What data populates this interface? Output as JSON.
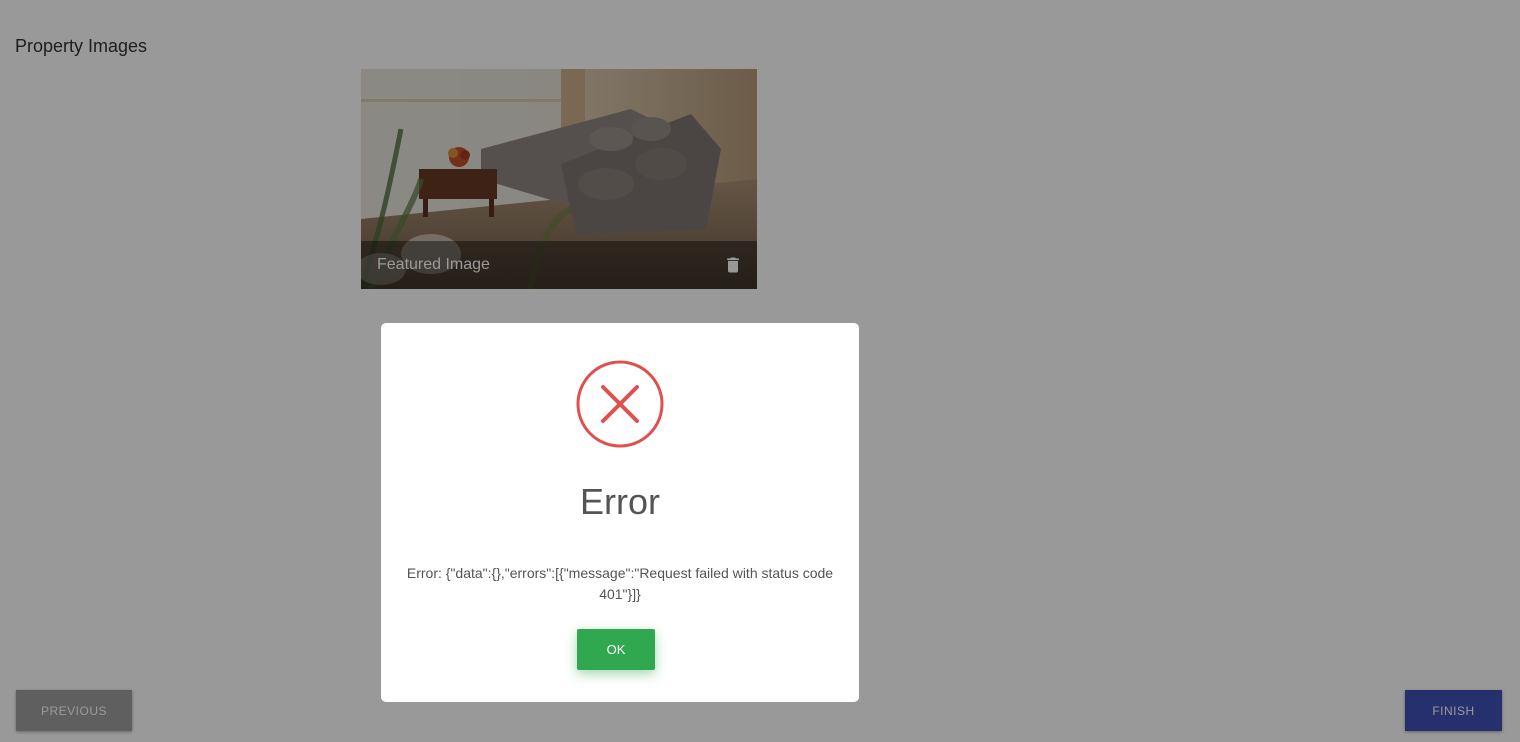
{
  "page": {
    "section_title": "Property Images"
  },
  "featured_image": {
    "caption": "Featured Image",
    "delete_icon": "trash-icon"
  },
  "navigation": {
    "previous_label": "PREVIOUS",
    "finish_label": "FINISH"
  },
  "dialog": {
    "icon": "error-x-icon",
    "title": "Error",
    "message": "Error: {\"data\":{},\"errors\":[{\"message\":\"Request failed with status code 401\"}]}",
    "ok_label": "OK"
  },
  "colors": {
    "error_red": "#e05050",
    "ok_green": "#2fa84f",
    "finish_blue": "#3f51b5",
    "previous_gray": "#9e9e9e"
  }
}
